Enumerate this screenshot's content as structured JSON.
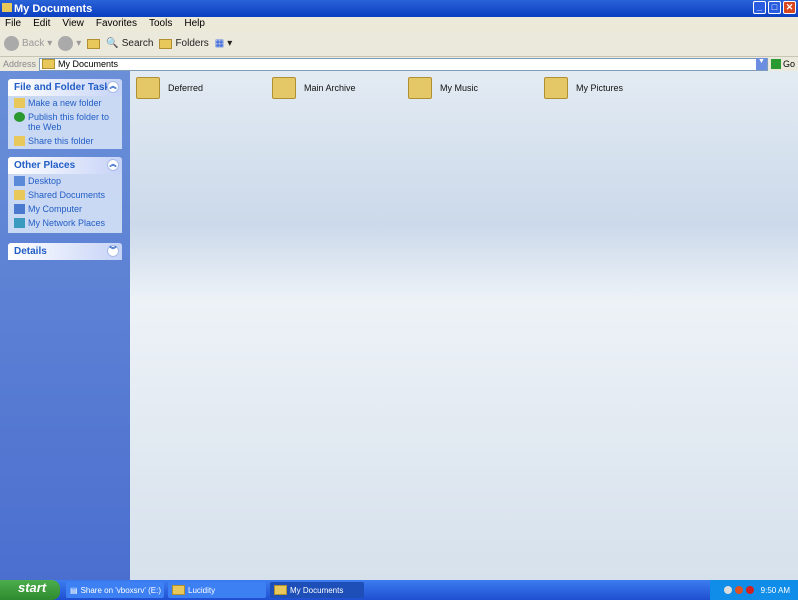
{
  "window": {
    "title": "My Documents"
  },
  "menu": [
    "File",
    "Edit",
    "View",
    "Favorites",
    "Tools",
    "Help"
  ],
  "toolbar": {
    "back": "Back",
    "search": "Search",
    "folders": "Folders"
  },
  "address": {
    "label": "Address",
    "value": "My Documents",
    "go": "Go"
  },
  "panels": {
    "tasks": {
      "title": "File and Folder Tasks",
      "items": [
        "Make a new folder",
        "Publish this folder to the Web",
        "Share this folder"
      ]
    },
    "places": {
      "title": "Other Places",
      "items": [
        "Desktop",
        "Shared Documents",
        "My Computer",
        "My Network Places"
      ]
    },
    "details": {
      "title": "Details"
    }
  },
  "folders": [
    "Deferred",
    "Main Archive",
    "My Music",
    "My Pictures"
  ],
  "taskbar": {
    "start": "start",
    "tasks": [
      "Share on 'vboxsrv' (E:)",
      "Lucidity",
      "My Documents"
    ],
    "clock": "9:50 AM"
  }
}
